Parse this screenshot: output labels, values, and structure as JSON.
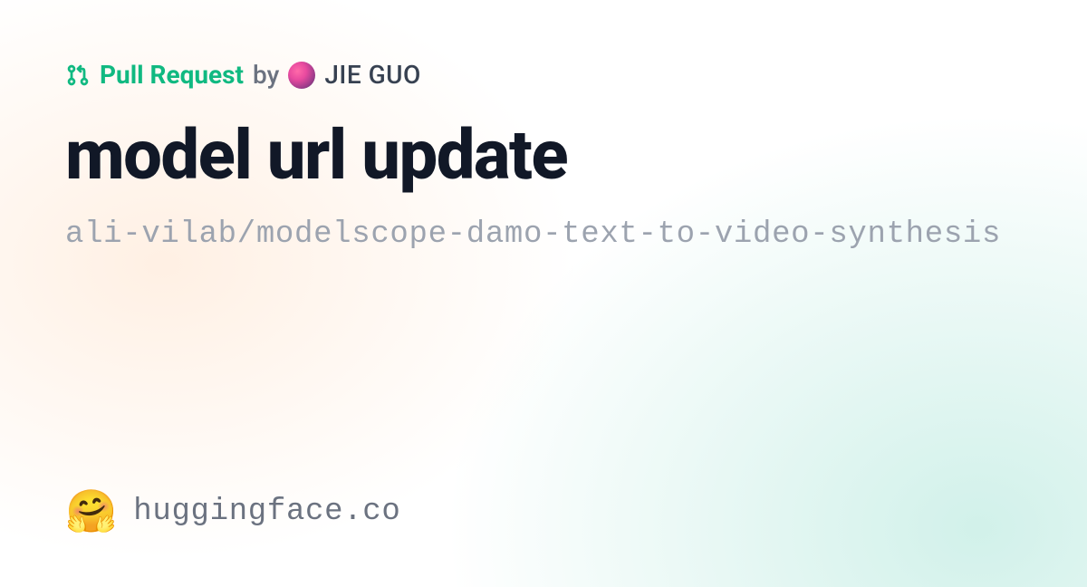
{
  "meta": {
    "label": "Pull Request",
    "by": "by",
    "author": "JIE GUO"
  },
  "title": "model url update",
  "repo": "ali-vilab/modelscope-damo-text-to-video-synthesis",
  "footer": {
    "site": "huggingface.co"
  }
}
